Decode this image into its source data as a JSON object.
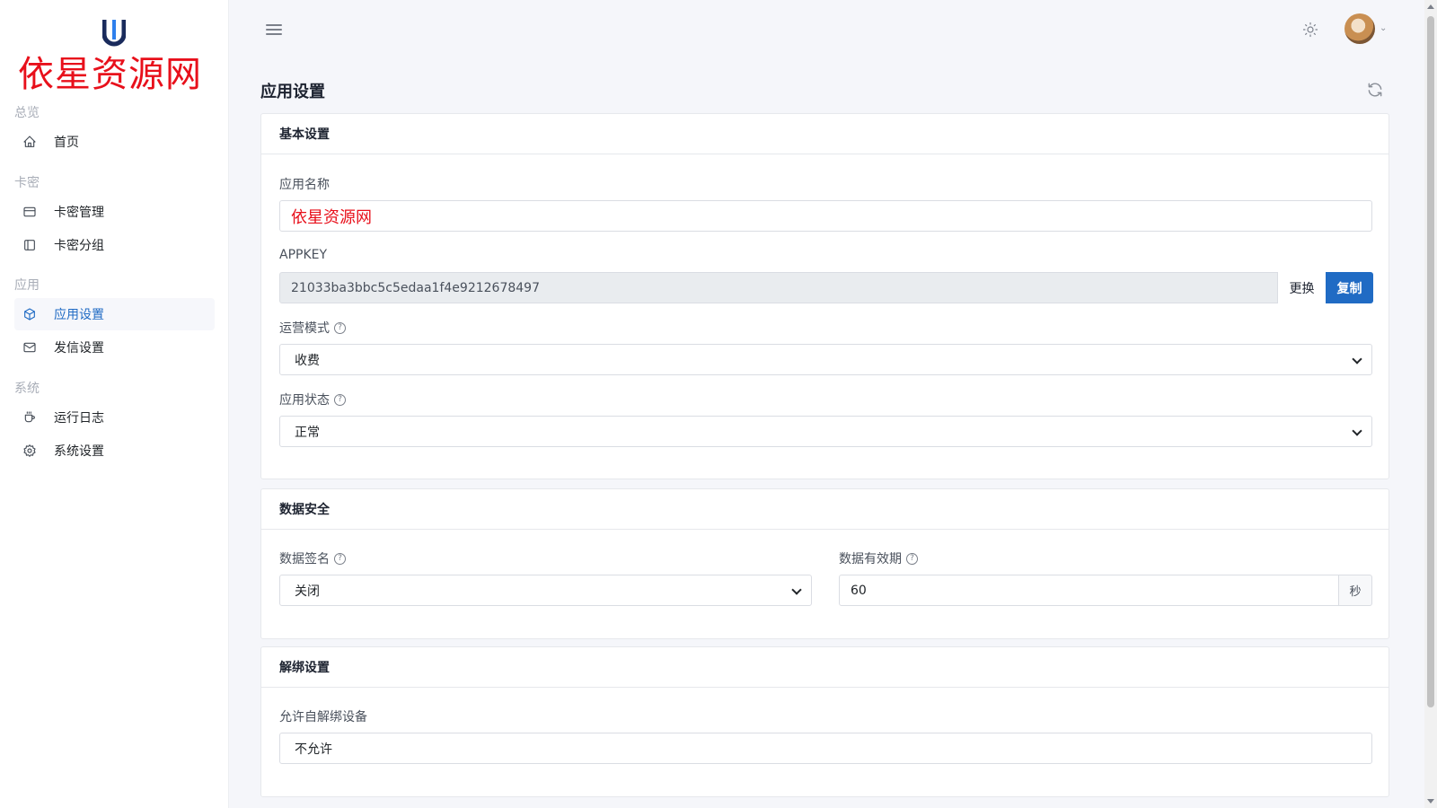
{
  "watermark": "依星资源网",
  "sidebar": {
    "sections": [
      {
        "title": "总览",
        "items": [
          {
            "label": "首页",
            "icon": "home-icon"
          }
        ]
      },
      {
        "title": "卡密",
        "items": [
          {
            "label": "卡密管理",
            "icon": "credit-card-icon"
          },
          {
            "label": "卡密分组",
            "icon": "layout-sidebar-icon"
          }
        ]
      },
      {
        "title": "应用",
        "items": [
          {
            "label": "应用设置",
            "icon": "cube-icon",
            "active": true
          },
          {
            "label": "发信设置",
            "icon": "mail-icon"
          }
        ]
      },
      {
        "title": "系统",
        "items": [
          {
            "label": "运行日志",
            "icon": "mug-icon"
          },
          {
            "label": "系统设置",
            "icon": "gear-icon"
          }
        ]
      }
    ]
  },
  "header": {
    "page_title": "应用设置"
  },
  "basic": {
    "title": "基本设置",
    "app_name_label": "应用名称",
    "app_name_value": "依星资源网",
    "appkey_label": "APPKEY",
    "appkey_value": "21033ba3bbc5c5edaa1f4e9212678497",
    "change_label": "更换",
    "copy_label": "复制",
    "mode_label": "运营模式",
    "mode_value": "收费",
    "status_label": "应用状态",
    "status_value": "正常"
  },
  "security": {
    "title": "数据安全",
    "sign_label": "数据签名",
    "sign_value": "关闭",
    "validity_label": "数据有效期",
    "validity_value": "60",
    "validity_unit": "秒"
  },
  "unbind": {
    "title": "解绑设置",
    "allow_label": "允许自解绑设备",
    "allow_value": "不允许"
  },
  "colors": {
    "primary": "#206bc4",
    "watermark": "#e8101b"
  }
}
